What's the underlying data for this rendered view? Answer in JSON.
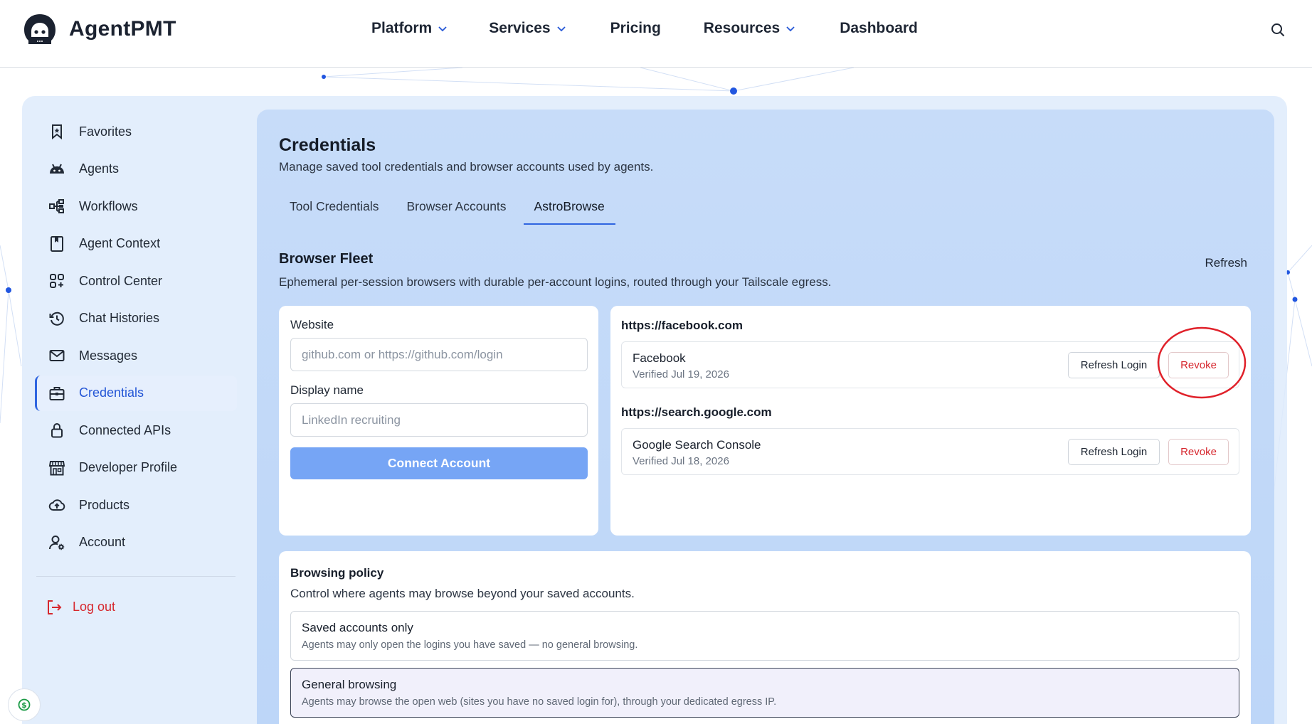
{
  "header": {
    "brand": "AgentPMT",
    "nav": [
      {
        "label": "Platform",
        "has_menu": true
      },
      {
        "label": "Services",
        "has_menu": true
      },
      {
        "label": "Pricing",
        "has_menu": false
      },
      {
        "label": "Resources",
        "has_menu": true
      },
      {
        "label": "Dashboard",
        "has_menu": false
      }
    ],
    "search_icon": "search-icon"
  },
  "sidebar": {
    "items": [
      {
        "label": "Favorites",
        "icon": "bookmark-icon"
      },
      {
        "label": "Agents",
        "icon": "android-icon"
      },
      {
        "label": "Workflows",
        "icon": "workflow-icon"
      },
      {
        "label": "Agent Context",
        "icon": "book-icon"
      },
      {
        "label": "Control Center",
        "icon": "grid-plus-icon"
      },
      {
        "label": "Chat Histories",
        "icon": "history-icon"
      },
      {
        "label": "Messages",
        "icon": "mail-icon"
      },
      {
        "label": "Credentials",
        "icon": "briefcase-icon",
        "active": true
      },
      {
        "label": "Connected APIs",
        "icon": "lock-icon"
      },
      {
        "label": "Developer Profile",
        "icon": "storefront-icon"
      },
      {
        "label": "Products",
        "icon": "cloud-upload-icon"
      },
      {
        "label": "Account",
        "icon": "user-gear-icon"
      }
    ],
    "logout_label": "Log out"
  },
  "main": {
    "title": "Credentials",
    "subtitle": "Manage saved tool credentials and browser accounts used by agents.",
    "tabs": [
      {
        "label": "Tool Credentials",
        "active": false
      },
      {
        "label": "Browser Accounts",
        "active": false
      },
      {
        "label": "AstroBrowse",
        "active": true
      }
    ],
    "fleet": {
      "title": "Browser Fleet",
      "subtitle": "Ephemeral per-session browsers with durable per-account logins, routed through your Tailscale egress.",
      "refresh_label": "Refresh"
    },
    "form": {
      "website_label": "Website",
      "website_placeholder": "github.com or https://github.com/login",
      "website_value": "",
      "display_name_label": "Display name",
      "display_name_placeholder": "LinkedIn recruiting",
      "display_name_value": "",
      "connect_label": "Connect Account"
    },
    "accounts": [
      {
        "host": "https://facebook.com",
        "name": "Facebook",
        "verified": "Verified Jul 19, 2026",
        "refresh_label": "Refresh Login",
        "revoke_label": "Revoke"
      },
      {
        "host": "https://search.google.com",
        "name": "Google Search Console",
        "verified": "Verified Jul 18, 2026",
        "refresh_label": "Refresh Login",
        "revoke_label": "Revoke"
      }
    ],
    "policy": {
      "title": "Browsing policy",
      "subtitle": "Control where agents may browse beyond your saved accounts.",
      "options": [
        {
          "title": "Saved accounts only",
          "desc": "Agents may only open the logins you have saved — no general browsing.",
          "selected": false
        },
        {
          "title": "General browsing",
          "desc": "Agents may browse the open web (sites you have no saved login for), through your dedicated egress IP.",
          "selected": true
        }
      ]
    }
  },
  "colors": {
    "accent": "#2f65e0",
    "danger": "#d6272e",
    "connect_button": "#76a5f5",
    "panel": "#c7dcf9"
  }
}
